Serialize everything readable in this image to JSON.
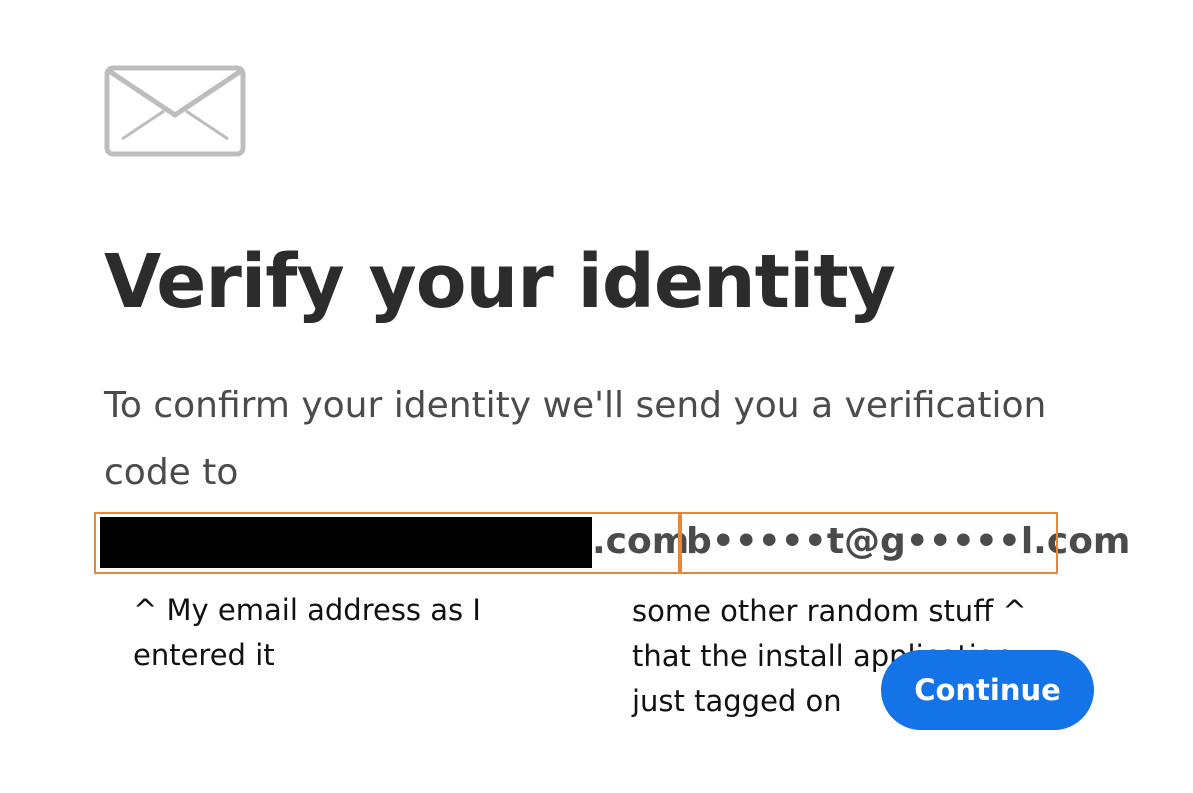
{
  "header": {
    "icon": "envelope-icon",
    "title": "Verify your identity"
  },
  "main": {
    "description": "To confirm your identity we'll send you a verification code to",
    "email_suffix": ".com",
    "email_masked": "b•••••t@g•••••l.com",
    "continue_label": "Continue"
  },
  "annotations": {
    "left_note": "^ My email address as I entered it",
    "right_note": "some other random stuff ^ that the install application just tagged on"
  },
  "colors": {
    "primary_button": "#1473e6",
    "annotation_box": "#e8873a",
    "title_text": "#2c2c2c",
    "body_text": "#4b4b4b",
    "icon_stroke": "#bdbdbd"
  }
}
